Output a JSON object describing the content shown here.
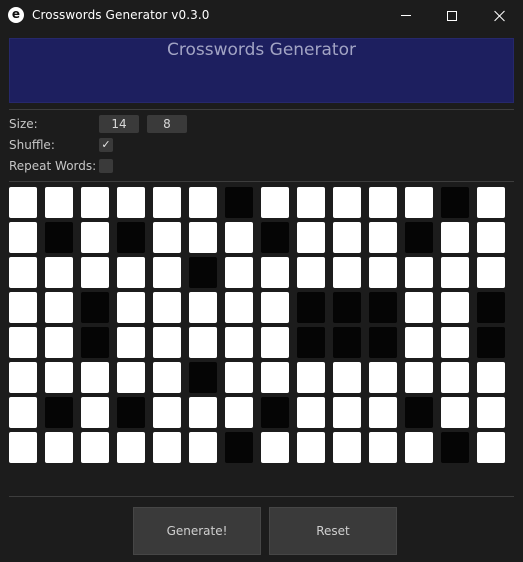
{
  "window": {
    "title": "Crosswords Generator v0.3.0",
    "icon_letter": "e",
    "controls": [
      "minimize-icon",
      "maximize-icon",
      "close-icon"
    ]
  },
  "banner": {
    "title": "Crosswords Generator"
  },
  "settings": {
    "size_label": "Size:",
    "size_width": "14",
    "size_height": "8",
    "shuffle_label": "Shuffle:",
    "shuffle_checked": true,
    "shuffle_mark": "✓",
    "repeat_label": "Repeat Words:",
    "repeat_checked": false,
    "repeat_mark": ""
  },
  "grid": {
    "cols": 14,
    "rows": [
      "WWWWWWBWWWWWBW",
      "WBWBWWWBWWWBWW",
      "WWWWWBWWWWWWWW",
      "WWBWWWWWBBBWWB",
      "WWBWWWWWBBBWWB",
      "WWWWWBWWWWWWWW",
      "WBWBWWWBWWWBWW",
      "WWWWWWBWWWWWBW"
    ],
    "colors": {
      "white": "#ffffff",
      "black": "#050505"
    }
  },
  "actions": {
    "generate_label": "Generate!",
    "reset_label": "Reset"
  },
  "colors": {
    "background": "#1c1c1c",
    "banner": "#1d1f5f",
    "banner_text": "#a2a4c4",
    "control": "#3a3a3a"
  }
}
